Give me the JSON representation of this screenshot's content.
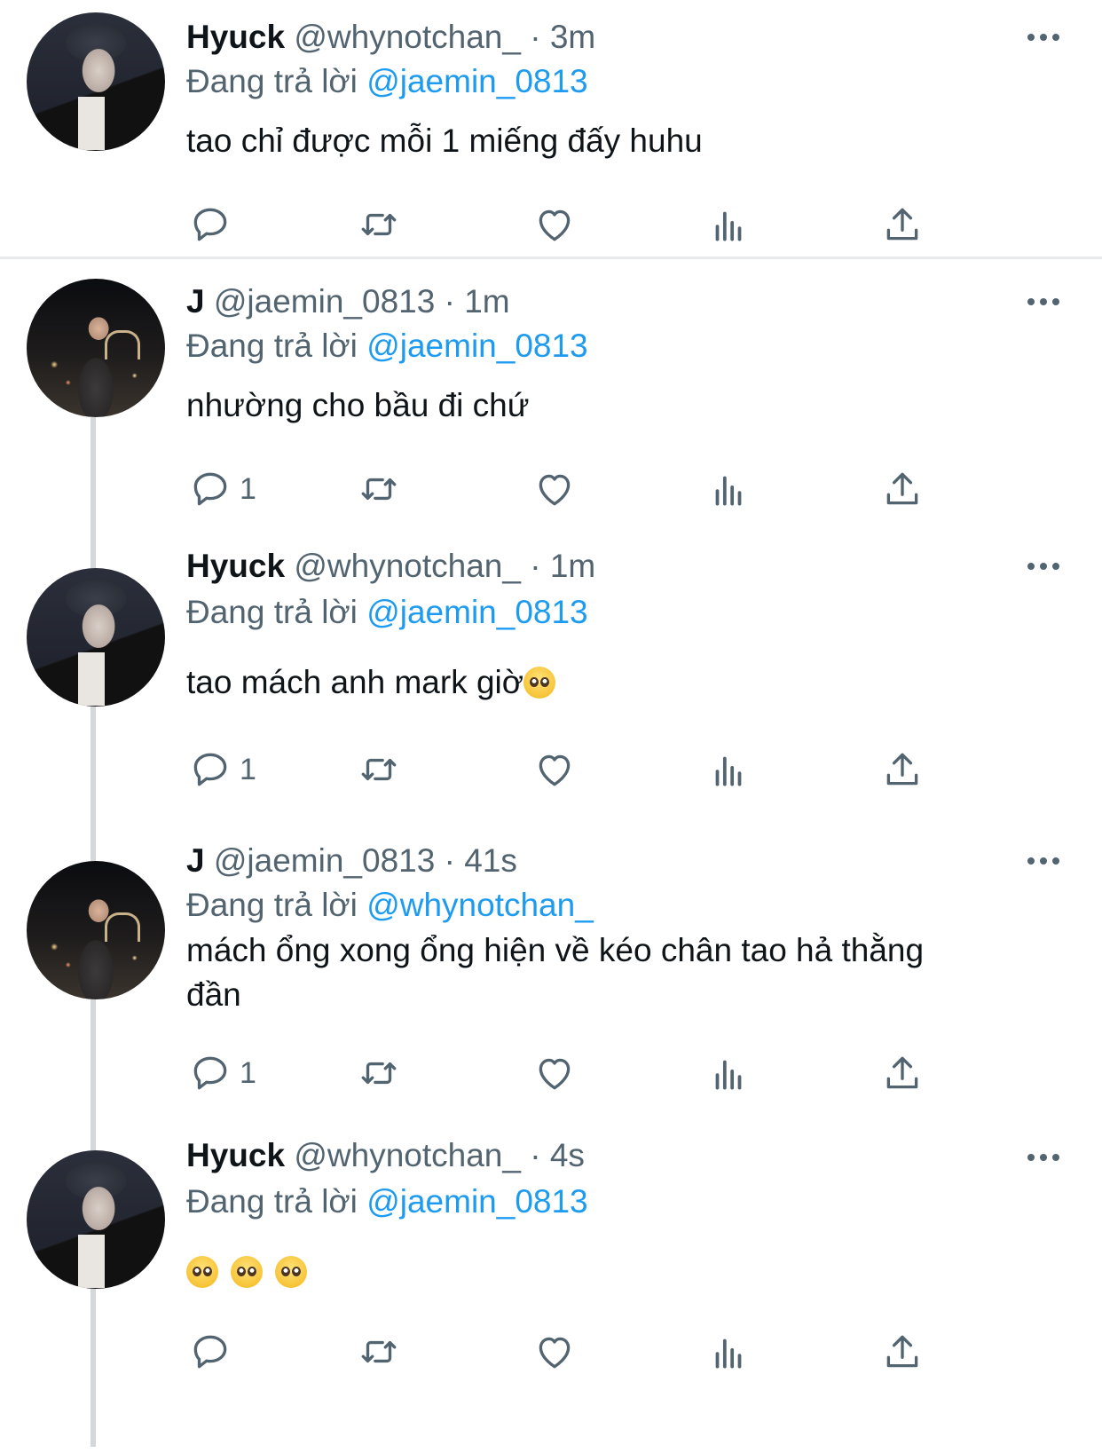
{
  "tweets": [
    {
      "name": "Hyuck",
      "handle": "@whynotchan_",
      "sep": "·",
      "time": "3m",
      "replying_prefix": "Đang trả lời",
      "replying_to": "@jaemin_0813",
      "text": "tao chỉ được mỗi 1 miếng đấy huhu",
      "reply_count": ""
    },
    {
      "name": "J",
      "handle": "@jaemin_0813",
      "sep": "·",
      "time": "1m",
      "replying_prefix": "Đang trả lời",
      "replying_to": "@jaemin_0813",
      "text": "nhường cho bầu đi chứ",
      "reply_count": "1"
    },
    {
      "name": "Hyuck",
      "handle": "@whynotchan_",
      "sep": "·",
      "time": "1m",
      "replying_prefix": "Đang trả lời",
      "replying_to": "@jaemin_0813",
      "text": "tao mách anh mark giờ",
      "text_emoji": "pleading-face-emoji",
      "reply_count": "1"
    },
    {
      "name": "J",
      "handle": "@jaemin_0813",
      "sep": "·",
      "time": "41s",
      "replying_prefix": "Đang trả lời",
      "replying_to": "@whynotchan_",
      "text": "mách ổng xong ổng hiện về kéo chân tao hả thằng đần",
      "reply_count": "1"
    },
    {
      "name": "Hyuck",
      "handle": "@whynotchan_",
      "sep": "·",
      "time": "4s",
      "replying_prefix": "Đang trả lời",
      "replying_to": "@jaemin_0813",
      "text": "",
      "text_emoji": "pleading-face-emoji x3",
      "reply_count": ""
    }
  ],
  "icons": {
    "reply": "reply-icon",
    "retweet": "retweet-icon",
    "like": "heart-icon",
    "analytics": "analytics-icon",
    "share": "share-icon",
    "more": "more-options-icon"
  },
  "colors": {
    "mention": "#1d9bf0",
    "secondary_text": "#536471",
    "primary_text": "#0f1419",
    "icon": "#536471",
    "divider": "#e7e9ea",
    "thread_line": "#d4d8db"
  }
}
